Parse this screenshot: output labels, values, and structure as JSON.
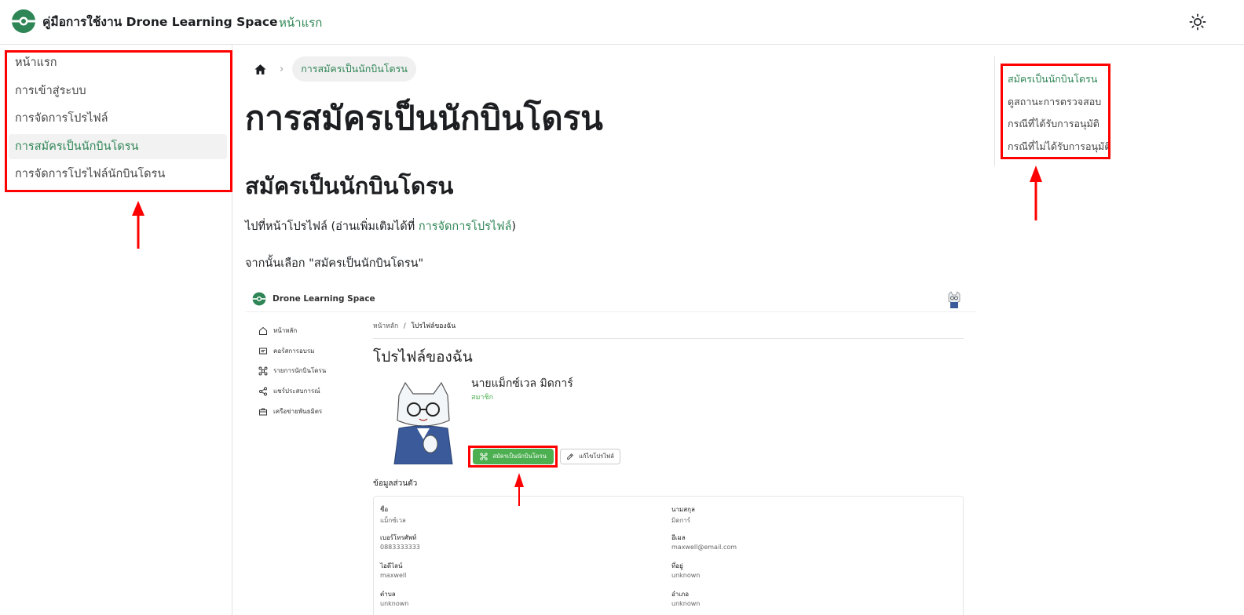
{
  "navbar": {
    "title": "คู่มือการใช้งาน Drone Learning Space",
    "home_link": "หน้าแรก",
    "theme_icon": "sun-icon"
  },
  "sidebar": {
    "items": [
      {
        "label": "หน้าแรก",
        "active": false
      },
      {
        "label": "การเข้าสู่ระบบ",
        "active": false
      },
      {
        "label": "การจัดการโปรไฟล์",
        "active": false
      },
      {
        "label": "การสมัครเป็นนักบินโดรน",
        "active": true
      },
      {
        "label": "การจัดการโปรไฟล์นักบินโดรน",
        "active": false
      }
    ]
  },
  "breadcrumb": {
    "home_icon": "home-icon",
    "current": "การสมัครเป็นนักบินโดรน"
  },
  "main": {
    "title": "การสมัครเป็นนักบินโดรน",
    "section_heading": "สมัครเป็นนักบินโดรน",
    "para1_prefix": "ไปที่หน้าโปรไฟล์ (อ่านเพิ่มเติมได้ที่ ",
    "para1_link": "การจัดการโปรไฟล์",
    "para1_suffix": ")",
    "para2": "จากนั้นเลือก \"สมัครเป็นนักบินโดรน\""
  },
  "toc": {
    "items": [
      {
        "label": "สมัครเป็นนักบินโดรน",
        "active": true
      },
      {
        "label": "ดูสถานะการตรวจสอบ",
        "active": false
      },
      {
        "label": "กรณีที่ได้รับการอนุมัติ",
        "active": false
      },
      {
        "label": "กรณีที่ไม่ได้รับการอนุมัติ",
        "active": false
      }
    ]
  },
  "screenshot": {
    "brand": "Drone Learning Space",
    "menu": [
      {
        "label": "หน้าหลัก",
        "icon": "home-icon"
      },
      {
        "label": "คอร์สการอบรม",
        "icon": "course-icon"
      },
      {
        "label": "รายการนักบินโดรน",
        "icon": "drone-icon"
      },
      {
        "label": "แชร์ประสบการณ์",
        "icon": "share-icon"
      },
      {
        "label": "เครือข่ายพันธมิตร",
        "icon": "briefcase-icon"
      }
    ],
    "breadcrumb_home": "หน้าหลัก",
    "breadcrumb_sep": "/",
    "breadcrumb_current": "โปรไฟล์ของฉัน",
    "page_title": "โปรไฟล์ของฉัน",
    "user_name": "นายแม็กซ์เวล มิดการ์",
    "user_role": "สมาชิก",
    "btn_pilot": "สมัครเป็นนักบินโดรน",
    "btn_edit": "แก้ไขโปรไฟล์",
    "section_title": "ข้อมูลส่วนตัว",
    "fields": [
      {
        "label": "ชื่อ",
        "value": "แม็กซ์เวล"
      },
      {
        "label": "นามสกุล",
        "value": "มิดการ์"
      },
      {
        "label": "เบอร์โทรศัพท์",
        "value": "0883333333"
      },
      {
        "label": "อีเมล",
        "value": "maxwell@email.com"
      },
      {
        "label": "ไอดีไลน์",
        "value": "maxwell"
      },
      {
        "label": "ที่อยู่",
        "value": "unknown"
      },
      {
        "label": "ตำบล",
        "value": "unknown"
      },
      {
        "label": "อำเภอ",
        "value": "unknown"
      }
    ]
  },
  "colors": {
    "accent": "#2e8555",
    "annotation": "#ff0000",
    "success": "#4caf50"
  }
}
